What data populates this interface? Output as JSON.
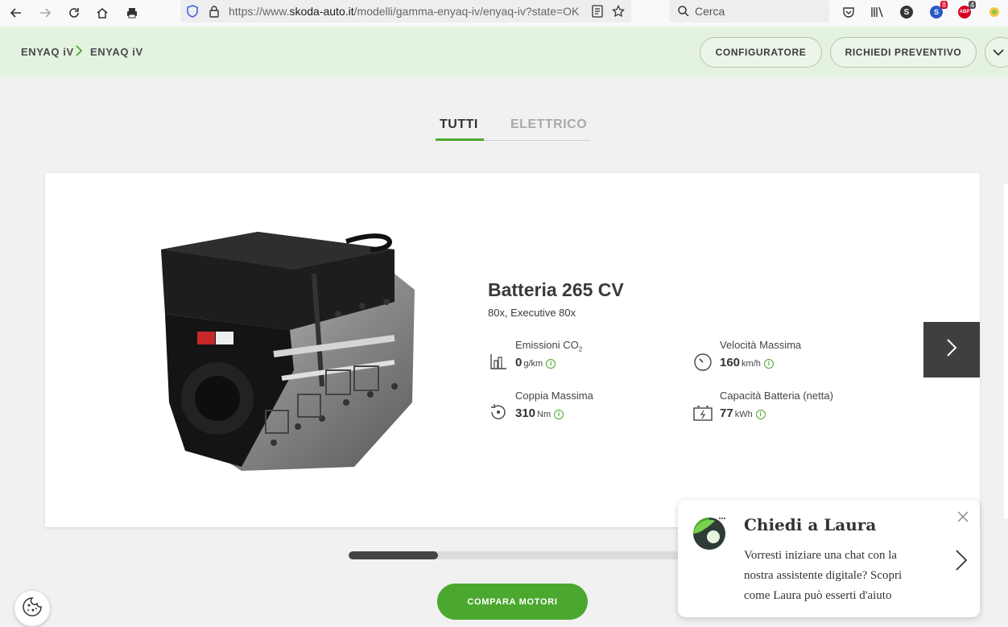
{
  "browser": {
    "url_prefix": "https://www.",
    "url_domain": "skoda-auto.it",
    "url_path": "/modelli/gamma-enyaq-iv/enyaq-iv?state=OK",
    "search_placeholder": "Cerca",
    "ext_badge_1": "8",
    "ext_badge_2": "4",
    "ext_label_s": "S",
    "ext_label_abp": "ABP"
  },
  "header": {
    "crumb_1": "ENYAQ iV",
    "crumb_2": "ENYAQ iV",
    "configuratore": "CONFIGURATORE",
    "preventivo": "RICHIEDI PREVENTIVO"
  },
  "tabs": [
    {
      "label": "TUTTI",
      "active": true
    },
    {
      "label": "ELETTRICO",
      "active": false
    }
  ],
  "engine": {
    "title": "Batteria 265 CV",
    "subtitle": "80x, Executive 80x",
    "specs": [
      {
        "label": "Emissioni CO",
        "label_sub": "2",
        "value": "0",
        "unit": "g/km",
        "icon": "emissions-icon"
      },
      {
        "label": "Velocità Massima",
        "value": "160",
        "unit": "km/h",
        "icon": "speedometer-icon"
      },
      {
        "label": "Coppia Massima",
        "value": "310",
        "unit": "Nm",
        "icon": "torque-icon"
      },
      {
        "label": "Capacità Batteria (netta)",
        "value": "77",
        "unit": "kWh",
        "icon": "battery-icon"
      }
    ]
  },
  "info_glyph": "i",
  "carousel_progress": 0.27,
  "compare_button": "COMPARA MOTORI",
  "chat": {
    "title": "Chiedi a Laura",
    "text": "Vorresti iniziare una chat con la nostra assistente digitale? Scopri come Laura può esserti d'aiuto"
  },
  "colors": {
    "accent": "#4ba82e",
    "header_bg": "#e4f3e0",
    "dark_button": "#3f3f3f"
  }
}
